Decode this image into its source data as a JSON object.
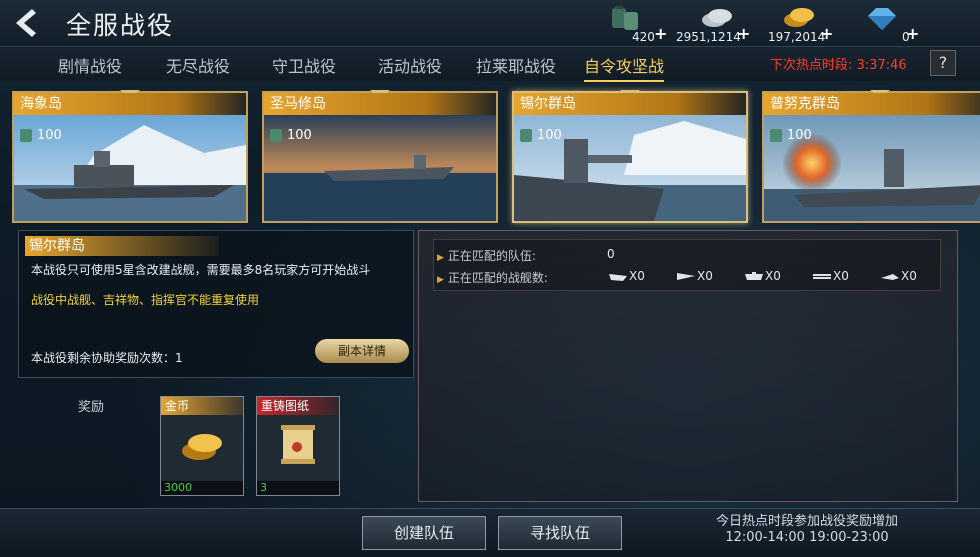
{
  "header": {
    "title": "全服战役",
    "currencies": [
      {
        "icon": "fuel-tank-icon",
        "value": "420"
      },
      {
        "icon": "silver-coin-icon",
        "value": "2951,1214"
      },
      {
        "icon": "gold-coin-icon",
        "value": "197,2014"
      },
      {
        "icon": "diamond-icon",
        "value": "0"
      }
    ]
  },
  "tabs": [
    "剧情战役",
    "无尽战役",
    "守卫战役",
    "活动战役",
    "拉莱耶战役",
    "自令攻坚战"
  ],
  "active_tab": "自令攻坚战",
  "hot_time": {
    "label": "下次热点时段:",
    "value": "3:37:46"
  },
  "help": "?",
  "campaigns": [
    {
      "name": "海象岛",
      "cost": "100"
    },
    {
      "name": "圣马修岛",
      "cost": "100"
    },
    {
      "name": "锡尔群岛",
      "cost": "100"
    },
    {
      "name": "普努克群岛",
      "cost": "100"
    }
  ],
  "info": {
    "title": "锡尔群岛",
    "desc": "本战役只可使用5星含改建战舰，需要最多8名玩家方可开始战斗",
    "warn": "战役中战舰、吉祥物、指挥官不能重复使用",
    "remain": "本战役剩余协助奖励次数：1",
    "detail_button": "副本详情"
  },
  "rewards": {
    "label": "奖励",
    "items": [
      {
        "name": "金币",
        "count": "3000"
      },
      {
        "name": "重铸图纸",
        "count": "3"
      }
    ]
  },
  "matching": {
    "teams_label": "正在匹配的队伍:",
    "teams_value": "0",
    "ships_label": "正在匹配的战舰数:",
    "ship_counts": [
      "X0",
      "X0",
      "X0",
      "X0",
      "X0"
    ]
  },
  "buttons": {
    "create": "创建队伍",
    "find": "寻找队伍"
  },
  "notice": {
    "line1": "今日热点时段参加战役奖励增加",
    "line2": "12:00-14:00 19:00-23:00"
  },
  "colors": {
    "accent": "#f5cf5b",
    "hot": "#ff3b2e",
    "warn": "#f0d23a",
    "count": "#39d33b"
  }
}
